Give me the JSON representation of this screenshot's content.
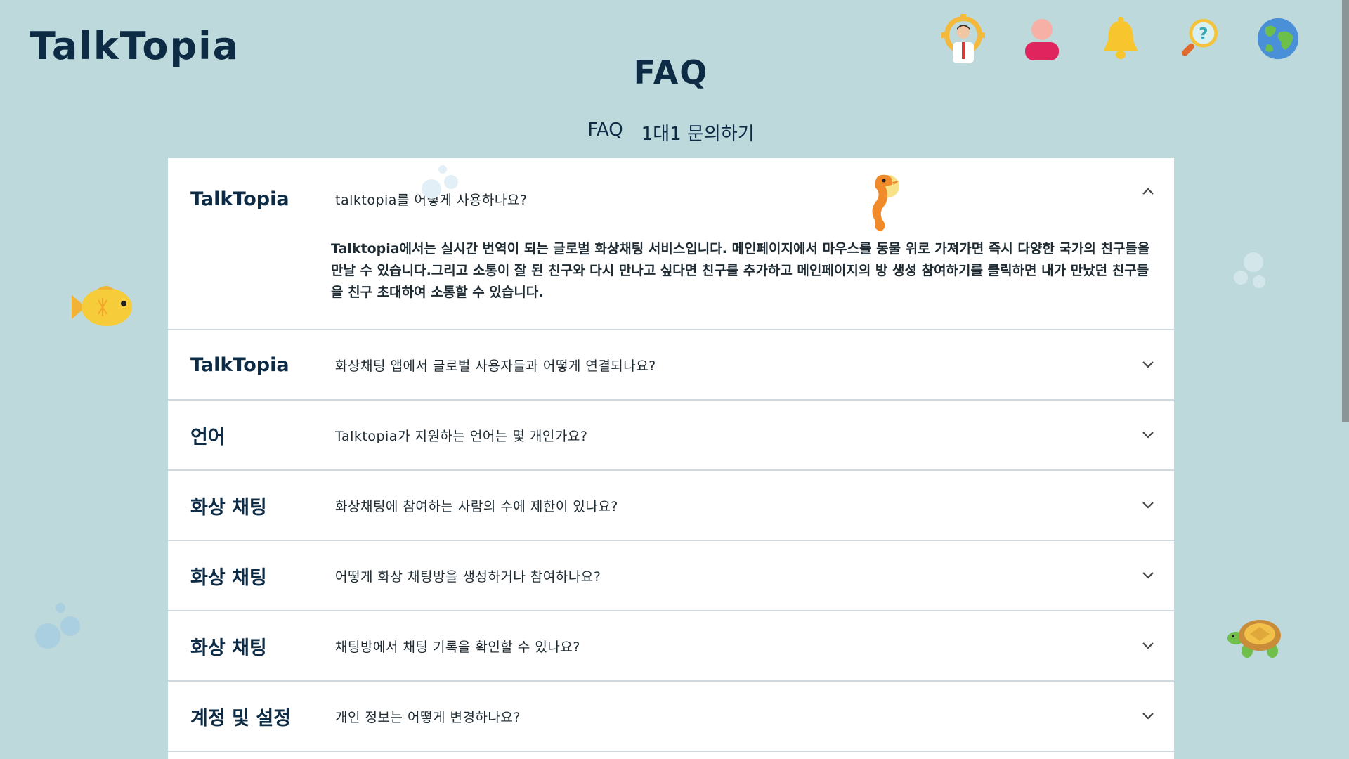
{
  "header": {
    "logo": "TalkTopia",
    "title": "FAQ",
    "icons": [
      "profile-settings-icon",
      "user-icon",
      "bell-icon",
      "help-search-icon",
      "globe-icon"
    ]
  },
  "tabs": [
    {
      "label": "FAQ"
    },
    {
      "label": "1대1 문의하기"
    }
  ],
  "faq": [
    {
      "category": "TalkTopia",
      "question": "talktopia를 어떻게 사용하나요?",
      "answer": "Talktopia에서는 실시간 번역이 되는 글로벌 화상채팅 서비스입니다. 메인페이지에서 마우스를 동물 위로 가져가면 즉시 다양한 국가의 친구들을 만날 수 있습니다.그리고 소통이 잘 된 친구와 다시 만나고 싶다면 친구를 추가하고 메인페이지의 방 생성 참여하기를 클릭하면 내가 만났던 친구들을 친구 초대하여 소통할 수 있습니다.",
      "open": true
    },
    {
      "category": "TalkTopia",
      "question": "화상채팅 앱에서 글로벌 사용자들과 어떻게 연결되나요?",
      "open": false
    },
    {
      "category": "언어",
      "question": "Talktopia가 지원하는 언어는 몇 개인가요?",
      "open": false
    },
    {
      "category": "화상 채팅",
      "question": "화상채팅에 참여하는 사람의 수에 제한이 있나요?",
      "open": false
    },
    {
      "category": "화상 채팅",
      "question": "어떻게 화상 채팅방을 생성하거나 참여하나요?",
      "open": false
    },
    {
      "category": "화상 채팅",
      "question": "채팅방에서 채팅 기록을 확인할 수 있나요?",
      "open": false
    },
    {
      "category": "계정 및 설정",
      "question": "개인 정보는 어떻게 변경하나요?",
      "open": false
    }
  ],
  "colors": {
    "background": "#bdd9dc",
    "text_dark": "#0d2b45",
    "panel": "#ffffff"
  }
}
